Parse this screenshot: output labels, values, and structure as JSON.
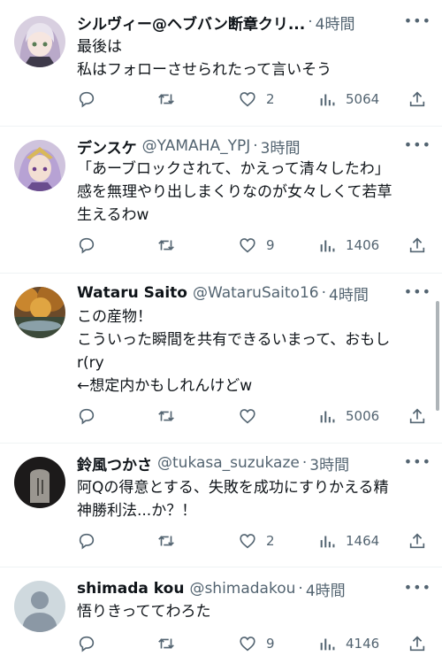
{
  "tweets": [
    {
      "name": "シルヴィー@ヘブバン断章クリ...",
      "handle": "",
      "time": "4時間",
      "lines": [
        "最後は",
        "私はフォローさせられたって言いそう"
      ],
      "replies": "",
      "retweets": "",
      "likes": "2",
      "views": "5064"
    },
    {
      "name": "デンスケ",
      "handle": "@YAMAHA_YPJ",
      "time": "3時間",
      "lines": [
        "「あーブロックされて、かえって清々したわ」",
        "感を無理やり出しまくりなのが女々しくて若草",
        "生えるわw"
      ],
      "replies": "",
      "retweets": "",
      "likes": "9",
      "views": "1406"
    },
    {
      "name": "Wataru Saito",
      "handle": "@WataruSaito16",
      "time": "4時間",
      "lines": [
        "この産物！",
        "こういった瞬間を共有できるいまって、おもし",
        "r(ry",
        "←想定内かもしれんけどw"
      ],
      "replies": "",
      "retweets": "",
      "likes": "",
      "views": "5006"
    },
    {
      "name": "鈴風つかさ",
      "handle": "@tukasa_suzukaze",
      "time": "3時間",
      "lines": [
        "阿Qの得意とする、失敗を成功にすりかえる精",
        "神勝利法...か？！"
      ],
      "replies": "",
      "retweets": "",
      "likes": "2",
      "views": "1464"
    },
    {
      "name": "shimada kou",
      "handle": "@shimadakou",
      "time": "4時間",
      "lines": [
        "悟りきっててわろた"
      ],
      "replies": "",
      "retweets": "",
      "likes": "9",
      "views": "4146"
    }
  ],
  "icons": {
    "reply": "speech-bubble",
    "retweet": "repeat-arrows",
    "like": "heart",
    "views": "bar-chart",
    "share": "upload-arrow",
    "more": "ellipsis"
  },
  "colors": {
    "text": "#0f1419",
    "secondary": "#536471",
    "divider": "#eff3f4"
  }
}
